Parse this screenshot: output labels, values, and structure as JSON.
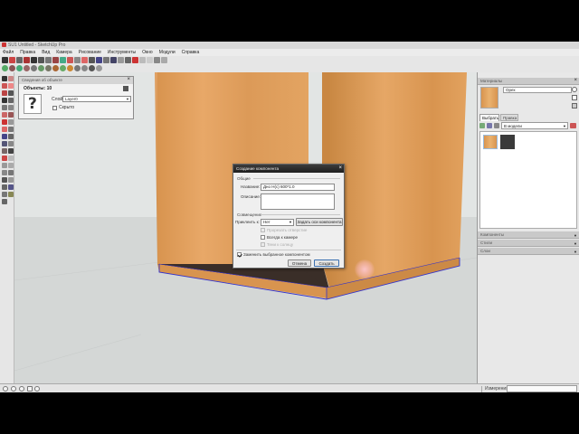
{
  "window": {
    "title": "SU1 Untitled - SketchUp Pro"
  },
  "menu": {
    "items": [
      "Файл",
      "Правка",
      "Вид",
      "Камера",
      "Рисование",
      "Инструменты",
      "Окно",
      "Модули",
      "Справка"
    ]
  },
  "entity_info": {
    "title": "Сведения об объекте",
    "heading": "Объекты: 10",
    "layer_label": "Слой:",
    "layer_value": "Layer0",
    "hidden_label": "Скрыто"
  },
  "dialog": {
    "title": "Создание компонента",
    "general_section": "Общие",
    "name_label": "Название:",
    "name_value": "Дно Н(с) 600*1.0",
    "description_label": "Описание:",
    "description_value": "",
    "alignment_section": "Совмещение",
    "glue_label": "Приклеить к:",
    "glue_value": "Нет",
    "set_axes_button": "Задать оси компонента",
    "cut_opening_label": "Прорезать отверстие",
    "face_camera_label": "Всегда к камере",
    "shadows_label": "Тени к солнцу",
    "replace_selection_label": "Заменить выбранное компонентом",
    "replace_selection_checked": true,
    "cancel_button": "Отмена",
    "create_button": "Создать"
  },
  "right_panel": {
    "materials_title": "Материалы",
    "material_name": "Орех",
    "tab_select": "Выбрать",
    "tab_edit": "Правка",
    "collection": "В модели",
    "components_title": "Компоненты",
    "styles_title": "Стили",
    "layers_title": "Слои"
  },
  "status": {
    "measure_label": "Измерения",
    "measure_value": ""
  },
  "colors": {
    "wood_light": "#e6a564",
    "wood_mid": "#d89550",
    "wood_dark": "#c47f3c",
    "floor_dark": "#3a2e28",
    "edge_blue": "#3333cc",
    "sky": "#e2e5e4",
    "ground": "#d4d7d6"
  },
  "icons": [
    "question-mark-icon",
    "checkmark-icon",
    "close-icon",
    "dropdown-arrow-icon"
  ]
}
